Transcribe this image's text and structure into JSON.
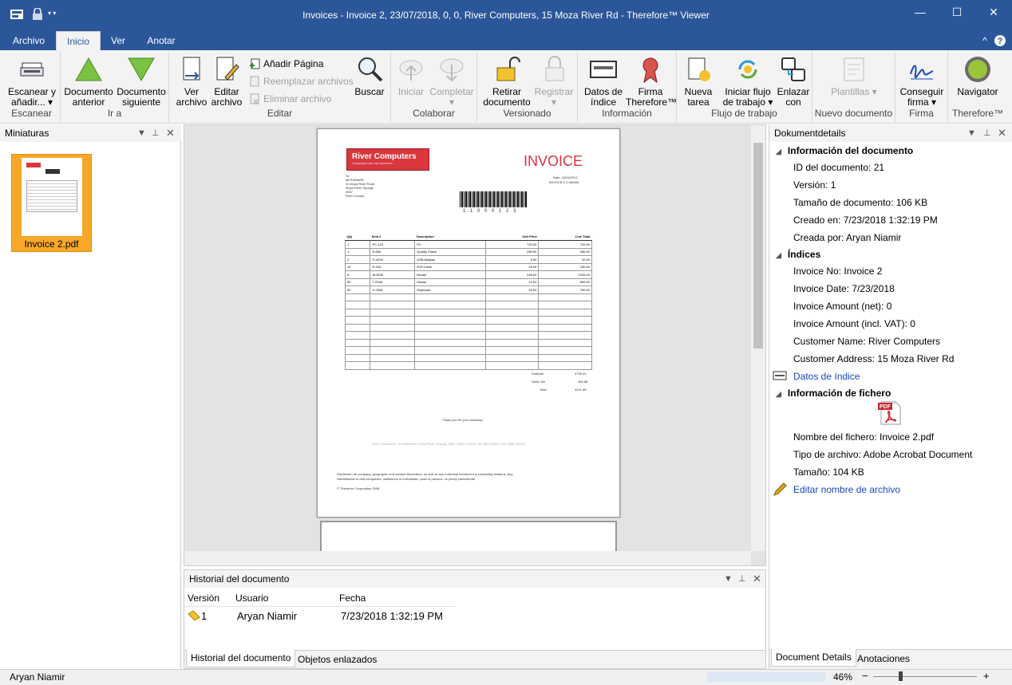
{
  "window": {
    "title": "Invoices - Invoice 2, 23/07/2018, 0, 0, River Computers, 15 Moza River Rd - Therefore™ Viewer"
  },
  "tabs": [
    {
      "label": "Archivo"
    },
    {
      "label": "Inicio"
    },
    {
      "label": "Ver"
    },
    {
      "label": "Anotar"
    }
  ],
  "ribbon": {
    "escanear": {
      "label": "Escanear",
      "btn": "Escanear y añadir... ▾"
    },
    "ira": {
      "label": "Ir a",
      "prev": "Documento anterior",
      "next": "Documento siguiente"
    },
    "editar": {
      "label": "Editar",
      "ver": "Ver archivo",
      "editar": "Editar archivo",
      "anadir": "Añadir Página",
      "reemplazar": "Reemplazar archivos",
      "eliminar": "Eliminar archivo",
      "buscar": "Buscar"
    },
    "colaborar": {
      "label": "Colaborar",
      "iniciar": "Iniciar",
      "completar": "Completar ▾"
    },
    "versionado": {
      "label": "Versionado",
      "retirar": "Retirar documento",
      "registrar": "Registrar ▾"
    },
    "informacion": {
      "label": "Información",
      "datos": "Datos de índice",
      "firma": "Firma Therefore™"
    },
    "flujo": {
      "label": "Flujo de trabajo",
      "nueva": "Nueva tarea",
      "iniciar": "Iniciar flujo de trabajo ▾",
      "enlazar": "Enlazar con"
    },
    "nuevo": {
      "label": "Nuevo documento",
      "plantillas": "Plantillas ▾"
    },
    "firma": {
      "label": "Firma",
      "conseguir": "Conseguir firma ▾"
    },
    "therefore": {
      "label": "Therefore™",
      "navigator": "Navigator"
    }
  },
  "thumbnails": {
    "title": "Miniaturas",
    "items": [
      {
        "label": "Invoice 2.pdf"
      }
    ]
  },
  "invoice": {
    "company": "River Computers",
    "tagline": "Computers are our business...",
    "heading": "INVOICE",
    "date": "Date: 16/04/2012",
    "number": "INVOICE # 2-482481",
    "to": [
      "To:",
      "MOTAWARE",
      "11 Moya River Road",
      "Moya River Springs",
      "4567",
      "River County"
    ],
    "barcode": "1 1 0 0 0 1 2 3",
    "headers": [
      "Qty",
      "Item #",
      "Description",
      "Unit Price",
      "Line Total"
    ],
    "rows": [
      [
        "1",
        "PC-104",
        "PC",
        "720.00",
        "720.00"
      ],
      [
        "1",
        "S-654",
        "Quality Check",
        "280.00",
        "280.00"
      ],
      [
        "2",
        "G-4234",
        "USB Adaptor",
        "5.00",
        "10.00"
      ],
      [
        "10",
        "R-234",
        "RJ5 Cable",
        "15.00",
        "150.00"
      ],
      [
        "5",
        "W-6234",
        "Router",
        "245.00",
        "1225.00"
      ],
      [
        "50",
        "T-2345",
        "Mouse",
        "12.00",
        "600.00"
      ],
      [
        "50",
        "K-2345",
        "Keyboard",
        "15.00",
        "750.00"
      ]
    ],
    "subtotal": "3735.00",
    "salestax": "466.88",
    "total": "4201.88",
    "subtotal_label": "Subtotal",
    "salestax_label": "Sales Tax",
    "total_label": "Total",
    "thanks": "Thank you for your business!",
    "address": "River Computers, 39 Waterfront, Moya River Springs, 4567, River County, Tel: 5567-89111, Fax: 5567-89112",
    "disclaimer1": "Disclaimer: All company, geographic and contact information, as well as any individual mentioned is completely fictitious. Any",
    "disclaimer2": "resemblance to real companies, institutions or individuals—past or present—is purely coincidental",
    "copyright": "© Therefore Corporation 2008"
  },
  "history": {
    "title": "Historial del documento",
    "columns": [
      "Versión",
      "Usuario",
      "Fecha"
    ],
    "rows": [
      {
        "version": "1",
        "user": "Aryan Niamir",
        "date": "7/23/2018 1:32:19 PM"
      }
    ],
    "tabs": [
      "Historial del documento",
      "Objetos enlazados"
    ]
  },
  "details": {
    "title": "Dokumentdetails",
    "doc_section": "Información del documento",
    "doc": [
      "ID del documento: 21",
      "Versión: 1",
      "Tamaño de documento: 106 KB",
      "Creado en: 7/23/2018 1:32:19 PM",
      "Creada por: Aryan Niamir"
    ],
    "index_section": "Índices",
    "index": [
      "Invoice No:  Invoice 2",
      "Invoice Date:  7/23/2018",
      "Invoice Amount (net):  0",
      "Invoice Amount (incl. VAT):  0",
      "Customer Name:  River Computers",
      "Customer Address:  15 Moza River Rd"
    ],
    "index_link": "Datos de índice",
    "file_section": "Información de fichero",
    "file": [
      "Nombre del fichero: Invoice 2.pdf",
      "Tipo de archivo: Adobe Acrobat Document",
      "Tamaño: 104 KB"
    ],
    "file_link": "Editar nombre de archivo",
    "tabs": [
      "Document Details",
      "Anotaciones"
    ]
  },
  "status": {
    "user": "Aryan Niamir",
    "zoom": "46%"
  },
  "colors": {
    "brand": "#2b579a",
    "ribbon": "#f3f3f3",
    "invoice_red": "#d9363e"
  }
}
